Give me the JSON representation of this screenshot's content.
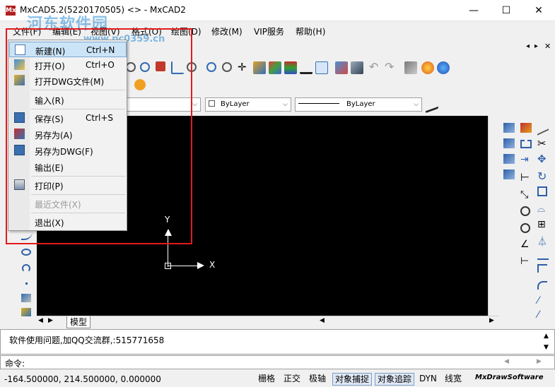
{
  "window": {
    "title": "MxCAD5.2(5220170505) <> - MxCAD2",
    "app_icon": "Mx",
    "minimize": "—",
    "maximize": "☐",
    "close": "✕"
  },
  "watermark": {
    "text": "河东软件园",
    "url": "www.pc0359.cn"
  },
  "menubar": {
    "items": [
      {
        "label": "文件(F)"
      },
      {
        "label": "编辑(E)"
      },
      {
        "label": "视图(V)"
      },
      {
        "label": "格式(O)"
      },
      {
        "label": "绘图(D)"
      },
      {
        "label": "修改(M)"
      },
      {
        "label": "VIP服务"
      },
      {
        "label": "帮助(H)"
      }
    ]
  },
  "file_menu": {
    "items": [
      {
        "label": "新建(N)",
        "shortcut": "Ctrl+N",
        "icon": "new-file-icon"
      },
      {
        "label": "打开(O)",
        "shortcut": "Ctrl+O",
        "icon": "open-file-icon"
      },
      {
        "label": "打开DWG文件(M)",
        "shortcut": "",
        "icon": "open-dwg-icon"
      },
      {
        "label": "输入(R)",
        "shortcut": "",
        "icon": ""
      },
      {
        "label": "保存(S)",
        "shortcut": "Ctrl+S",
        "icon": "save-icon"
      },
      {
        "label": "另存为(A)",
        "shortcut": "",
        "icon": "save-as-icon"
      },
      {
        "label": "另存为DWG(F)",
        "shortcut": "",
        "icon": "save-as-dwg-icon"
      },
      {
        "label": "输出(E)",
        "shortcut": "",
        "icon": ""
      },
      {
        "label": "打印(P)",
        "shortcut": "",
        "icon": "print-icon"
      },
      {
        "label": "最近文件(X)",
        "shortcut": "",
        "icon": ""
      },
      {
        "label": "退出(X)",
        "shortcut": "",
        "icon": ""
      }
    ]
  },
  "properties": {
    "color": "ByLayer",
    "linetype": "ByLayer"
  },
  "canvas": {
    "y_axis": "Y",
    "x_axis": "X"
  },
  "tabs": {
    "model": "模型"
  },
  "command": {
    "history": "软件使用问题,加QQ交流群,:515771658",
    "prompt": "命令:"
  },
  "status": {
    "coords": "-164.500000,  214.500000,  0.000000",
    "buttons": [
      {
        "label": "栅格",
        "on": false
      },
      {
        "label": "正交",
        "on": false
      },
      {
        "label": "极轴",
        "on": false
      },
      {
        "label": "对象捕捉",
        "on": true
      },
      {
        "label": "对象追踪",
        "on": true
      },
      {
        "label": "DYN",
        "on": false
      },
      {
        "label": "线宽",
        "on": false
      }
    ],
    "brand": "MxDrawSoftware"
  },
  "colors": {
    "canvas_bg": "#000000",
    "highlight": "#cce4f7",
    "annotation_red": "#e21b1b"
  }
}
